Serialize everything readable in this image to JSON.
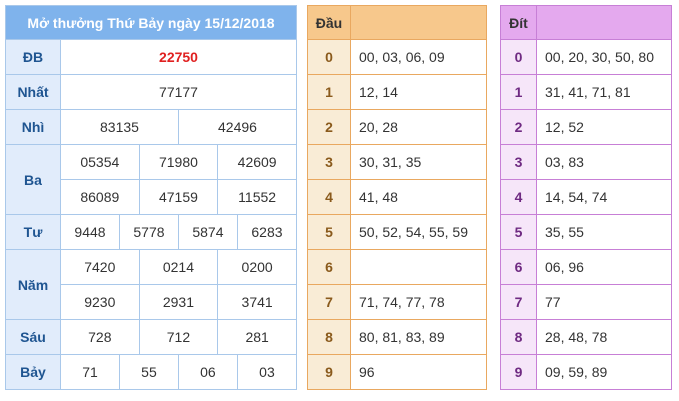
{
  "results": {
    "title": "Mở thưởng Thứ Bảy ngày 15/12/2018",
    "db": {
      "label": "ĐB",
      "value": "22750"
    },
    "nhat": {
      "label": "Nhất",
      "value": "77177"
    },
    "nhi": {
      "label": "Nhì",
      "values": [
        "83135",
        "42496"
      ]
    },
    "ba": {
      "label": "Ba",
      "values": [
        "05354",
        "71980",
        "42609",
        "86089",
        "47159",
        "11552"
      ]
    },
    "tu": {
      "label": "Tư",
      "values": [
        "9448",
        "5778",
        "5874",
        "6283"
      ]
    },
    "nam": {
      "label": "Năm",
      "values": [
        "7420",
        "0214",
        "0200",
        "9230",
        "2931",
        "3741"
      ]
    },
    "sau": {
      "label": "Sáu",
      "values": [
        "728",
        "712",
        "281"
      ]
    },
    "bay": {
      "label": "Bảy",
      "values": [
        "71",
        "55",
        "06",
        "03"
      ]
    }
  },
  "dau": {
    "header": "Đầu",
    "rows": [
      {
        "idx": "0",
        "val": "00, 03, 06, 09"
      },
      {
        "idx": "1",
        "val": "12, 14"
      },
      {
        "idx": "2",
        "val": "20, 28"
      },
      {
        "idx": "3",
        "val": "30, 31, 35"
      },
      {
        "idx": "4",
        "val": "41, 48"
      },
      {
        "idx": "5",
        "val": "50, 52, 54, 55, 59"
      },
      {
        "idx": "6",
        "val": ""
      },
      {
        "idx": "7",
        "val": "71, 74, 77, 78"
      },
      {
        "idx": "8",
        "val": "80, 81, 83, 89"
      },
      {
        "idx": "9",
        "val": "96"
      }
    ]
  },
  "dit": {
    "header": "Đít",
    "rows": [
      {
        "idx": "0",
        "val": "00, 20, 30, 50, 80"
      },
      {
        "idx": "1",
        "val": "31, 41, 71, 81"
      },
      {
        "idx": "2",
        "val": "12, 52"
      },
      {
        "idx": "3",
        "val": "03, 83"
      },
      {
        "idx": "4",
        "val": "14, 54, 74"
      },
      {
        "idx": "5",
        "val": "35, 55"
      },
      {
        "idx": "6",
        "val": "06, 96"
      },
      {
        "idx": "7",
        "val": "77"
      },
      {
        "idx": "8",
        "val": "28, 48, 78"
      },
      {
        "idx": "9",
        "val": "09, 59, 89"
      }
    ]
  },
  "colors": {
    "results_header": "#7fb3ec",
    "special_prize": "#e02020",
    "dau_header": "#f7c88c",
    "dit_header": "#e4a9ee"
  }
}
